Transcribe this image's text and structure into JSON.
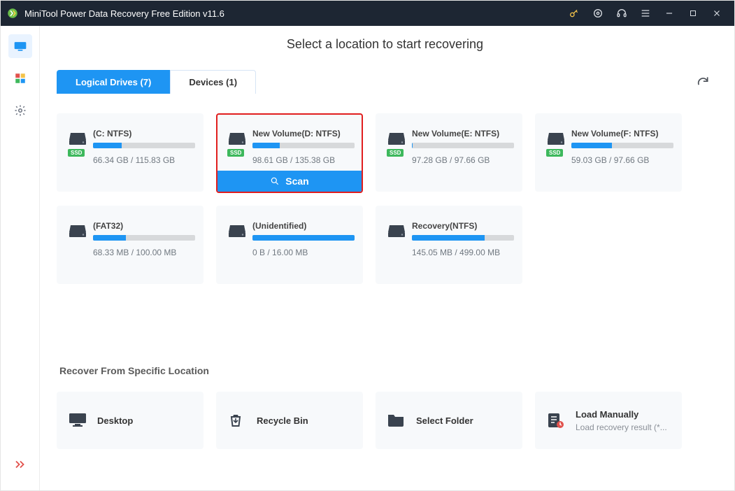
{
  "titlebar": {
    "title": "MiniTool Power Data Recovery Free Edition v11.6"
  },
  "headline": "Select a location to start recovering",
  "tabs": [
    {
      "label": "Logical Drives (7)",
      "active": true
    },
    {
      "label": "Devices (1)",
      "active": false
    }
  ],
  "scan_label": "Scan",
  "drives": [
    {
      "name": "(C: NTFS)",
      "size": "66.34 GB / 115.83 GB",
      "pct": 28,
      "ssd": true,
      "selected": false
    },
    {
      "name": "New Volume(D: NTFS)",
      "size": "98.61 GB / 135.38 GB",
      "pct": 27,
      "ssd": true,
      "selected": true
    },
    {
      "name": "New Volume(E: NTFS)",
      "size": "97.28 GB / 97.66 GB",
      "pct": 1,
      "ssd": true,
      "selected": false
    },
    {
      "name": "New Volume(F: NTFS)",
      "size": "59.03 GB / 97.66 GB",
      "pct": 40,
      "ssd": true,
      "selected": false
    },
    {
      "name": "(FAT32)",
      "size": "68.33 MB / 100.00 MB",
      "pct": 32,
      "ssd": false,
      "selected": false
    },
    {
      "name": "(Unidentified)",
      "size": "0 B / 16.00 MB",
      "pct": 100,
      "ssd": false,
      "selected": false
    },
    {
      "name": "Recovery(NTFS)",
      "size": "145.05 MB / 499.00 MB",
      "pct": 71,
      "ssd": false,
      "selected": false
    }
  ],
  "section2": {
    "title": "Recover From Specific Location"
  },
  "locations": [
    {
      "label": "Desktop",
      "sub": "",
      "icon": "desktop"
    },
    {
      "label": "Recycle Bin",
      "sub": "",
      "icon": "recycle"
    },
    {
      "label": "Select Folder",
      "sub": "",
      "icon": "folder"
    },
    {
      "label": "Load Manually",
      "sub": "Load recovery result (*...",
      "icon": "load"
    }
  ]
}
